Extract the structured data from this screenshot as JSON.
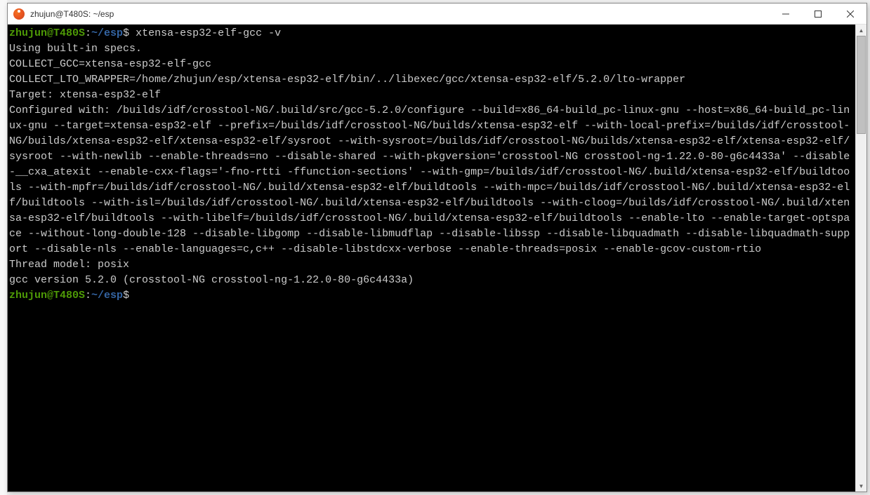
{
  "window": {
    "title": "zhujun@T480S: ~/esp"
  },
  "prompt1": {
    "user": "zhujun@T480S",
    "sep": ":",
    "path": "~/esp",
    "dollar": "$",
    "command": " xtensa-esp32-elf-gcc -v"
  },
  "output": {
    "line1": "Using built-in specs.",
    "line2": "COLLECT_GCC=xtensa-esp32-elf-gcc",
    "line3": "COLLECT_LTO_WRAPPER=/home/zhujun/esp/xtensa-esp32-elf/bin/../libexec/gcc/xtensa-esp32-elf/5.2.0/lto-wrapper",
    "line4": "Target: xtensa-esp32-elf",
    "line5": "Configured with: /builds/idf/crosstool-NG/.build/src/gcc-5.2.0/configure --build=x86_64-build_pc-linux-gnu --host=x86_64-build_pc-linux-gnu --target=xtensa-esp32-elf --prefix=/builds/idf/crosstool-NG/builds/xtensa-esp32-elf --with-local-prefix=/builds/idf/crosstool-NG/builds/xtensa-esp32-elf/xtensa-esp32-elf/sysroot --with-sysroot=/builds/idf/crosstool-NG/builds/xtensa-esp32-elf/xtensa-esp32-elf/sysroot --with-newlib --enable-threads=no --disable-shared --with-pkgversion='crosstool-NG crosstool-ng-1.22.0-80-g6c4433a' --disable-__cxa_atexit --enable-cxx-flags='-fno-rtti -ffunction-sections' --with-gmp=/builds/idf/crosstool-NG/.build/xtensa-esp32-elf/buildtools --with-mpfr=/builds/idf/crosstool-NG/.build/xtensa-esp32-elf/buildtools --with-mpc=/builds/idf/crosstool-NG/.build/xtensa-esp32-elf/buildtools --with-isl=/builds/idf/crosstool-NG/.build/xtensa-esp32-elf/buildtools --with-cloog=/builds/idf/crosstool-NG/.build/xtensa-esp32-elf/buildtools --with-libelf=/builds/idf/crosstool-NG/.build/xtensa-esp32-elf/buildtools --enable-lto --enable-target-optspace --without-long-double-128 --disable-libgomp --disable-libmudflap --disable-libssp --disable-libquadmath --disable-libquadmath-support --disable-nls --enable-languages=c,c++ --disable-libstdcxx-verbose --enable-threads=posix --enable-gcov-custom-rtio",
    "line6": "Thread model: posix",
    "line7": "gcc version 5.2.0 (crosstool-NG crosstool-ng-1.22.0-80-g6c4433a)"
  },
  "prompt2": {
    "user": "zhujun@T480S",
    "sep": ":",
    "path": "~/esp",
    "dollar": "$"
  }
}
